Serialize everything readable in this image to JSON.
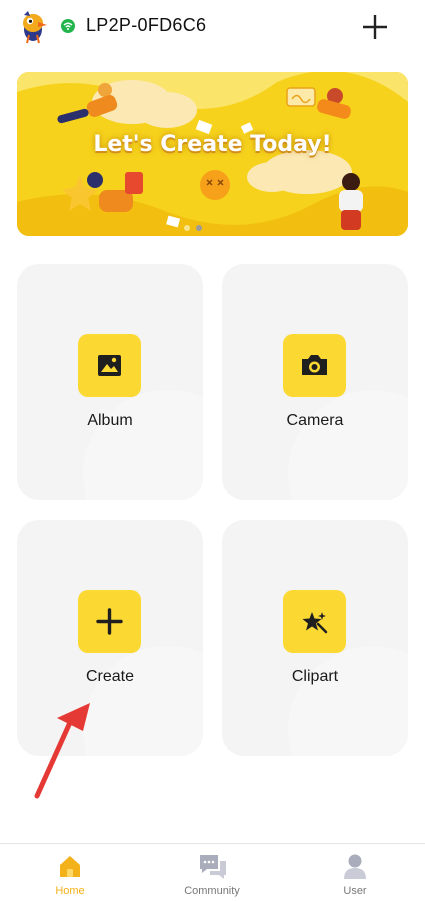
{
  "header": {
    "device_name": "LP2P-0FD6C6",
    "wifi_color": "#22b54c",
    "logo_icon": "bird-logo-icon",
    "add_icon": "plus-icon"
  },
  "banner": {
    "title": "Let's Create Today!",
    "page_count": 2,
    "active_page": 1,
    "background_color": "#f6d21c"
  },
  "tiles": [
    {
      "label": "Album",
      "icon": "image-icon"
    },
    {
      "label": "Camera",
      "icon": "camera-icon"
    },
    {
      "label": "Create",
      "icon": "plus-icon"
    },
    {
      "label": "Clipart",
      "icon": "star-sparkle-icon"
    }
  ],
  "accent_color": "#fcd832",
  "annotation": {
    "arrow_color": "#e53935",
    "points_to": "Create"
  },
  "bottom_nav": {
    "items": [
      {
        "label": "Home",
        "icon": "home-icon",
        "active": true
      },
      {
        "label": "Community",
        "icon": "chat-bubbles-icon",
        "active": false
      },
      {
        "label": "User",
        "icon": "user-icon",
        "active": false
      }
    ],
    "active_color": "#f3b11a"
  }
}
